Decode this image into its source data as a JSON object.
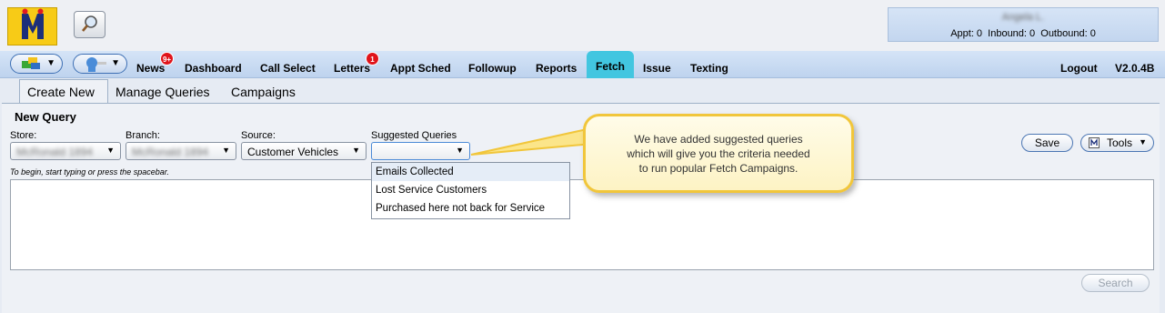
{
  "header": {
    "user_name": "Angela L.",
    "user_stats": "Appt: 0  Inbound: 0  Outbound: 0"
  },
  "nav": {
    "items": [
      "News",
      "Dashboard",
      "Call Select",
      "Letters",
      "Appt Sched",
      "Followup",
      "Reports",
      "Fetch",
      "Issue",
      "Texting"
    ],
    "active": "Fetch",
    "news_badge": "9+",
    "letters_badge": "1",
    "logout": "Logout",
    "version": "V2.0.4B"
  },
  "subtabs": {
    "create_new": "Create New",
    "manage_queries": "Manage Queries",
    "campaigns": "Campaigns"
  },
  "query": {
    "title": "New Query",
    "store_label": "Store:",
    "store_value": "McRonald 1894",
    "branch_label": "Branch:",
    "branch_value": "McRonald 1894",
    "source_label": "Source:",
    "source_value": "Customer Vehicles",
    "suggested_label": "Suggested Queries",
    "suggested_value": "",
    "hint": "To begin, start typing or press the spacebar.",
    "suggested_options": [
      "Emails Collected",
      "Lost Service Customers",
      "Purchased here not back for Service"
    ],
    "highlighted_option": "Emails Collected"
  },
  "buttons": {
    "save": "Save",
    "tools": "Tools",
    "search": "Search"
  },
  "callout": {
    "line1": "We have added suggested queries",
    "line2": "which will give you the criteria needed",
    "line3": "to run popular Fetch Campaigns."
  },
  "colors": {
    "logo_yellow": "#f7cb17",
    "active_tab": "#42c6e0",
    "badge_red": "#e0141b",
    "callout_border": "#f1c63b"
  },
  "icons": [
    "logo-icon",
    "magnifier-icon",
    "contacts-icon",
    "person-icon",
    "chevron-down-icon"
  ]
}
